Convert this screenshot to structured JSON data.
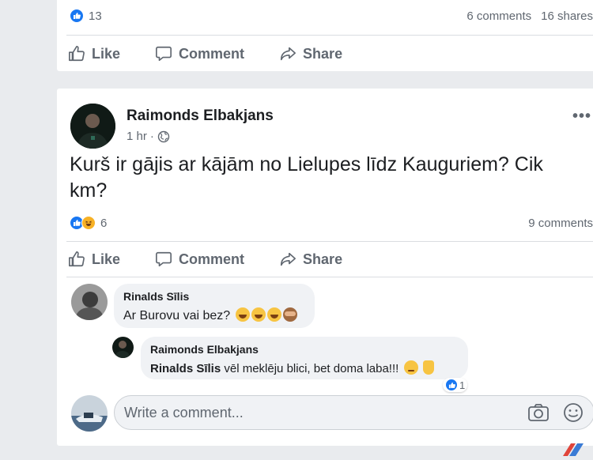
{
  "post_top": {
    "reactions_count": "13",
    "comments": "6 comments",
    "shares": "16 shares",
    "actions": {
      "like": "Like",
      "comment": "Comment",
      "share": "Share"
    }
  },
  "post_main": {
    "author": "Raimonds Elbakjans",
    "time": "1 hr",
    "separator": "·",
    "more": "•••",
    "text": "Kurš ir gājis ar kājām no Lielupes līdz Kauguriem? Cik km?",
    "reactions_count": "6",
    "comments": "9 comments",
    "actions": {
      "like": "Like",
      "comment": "Comment",
      "share": "Share"
    },
    "comment1": {
      "name": "Rinalds Sīlis",
      "text": "Ar Burovu vai bez?"
    },
    "reply1": {
      "name": "Raimonds Elbakjans",
      "mention": "Rinalds Sīlis",
      "text": " vēl meklēju blici, bet doma laba!!!",
      "reaction_count": "1"
    },
    "write_placeholder": "Write a comment..."
  },
  "colors": {
    "accent": "#1877f2",
    "background": "#e9ebee",
    "text_muted": "#606770"
  }
}
